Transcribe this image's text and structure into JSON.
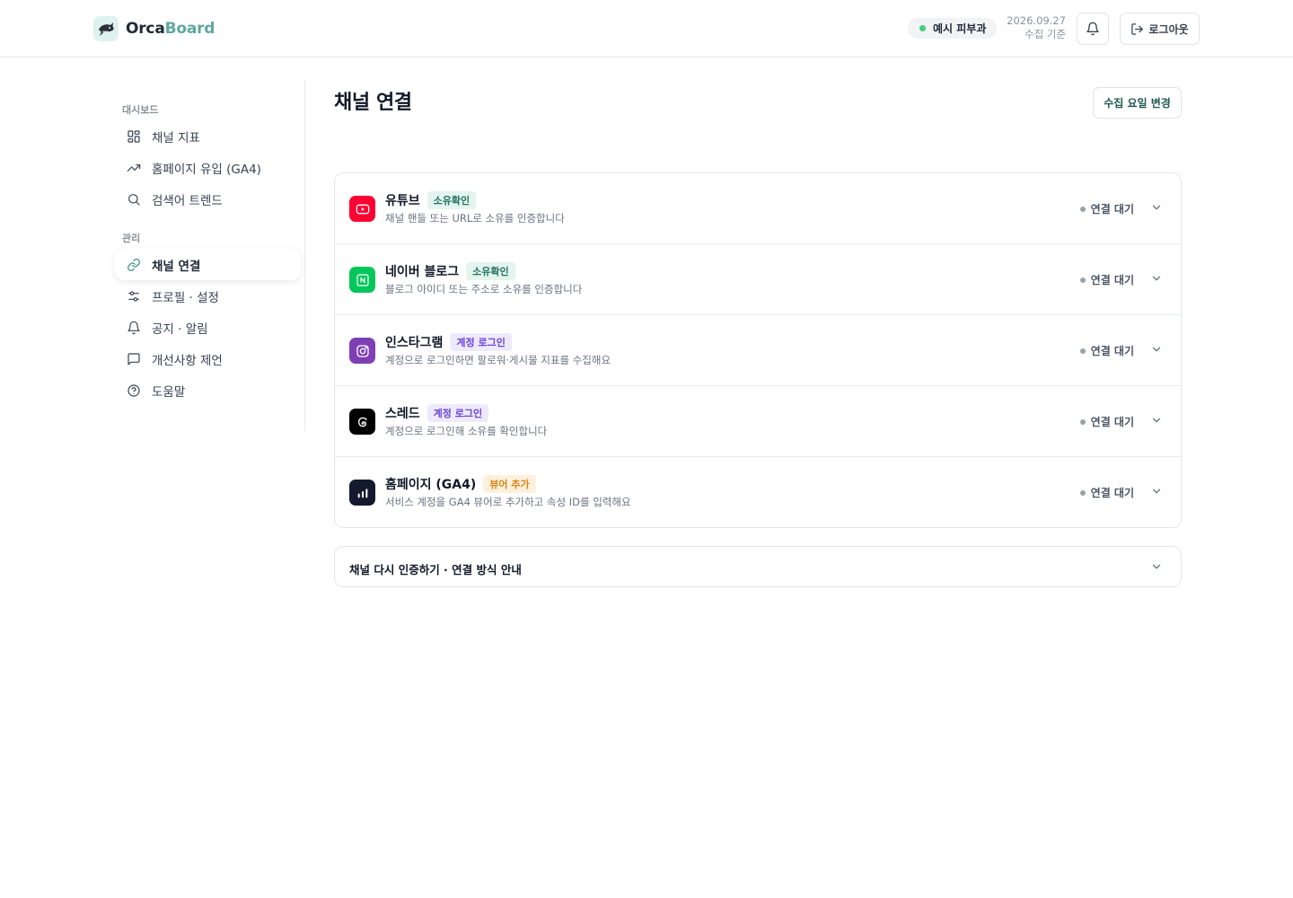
{
  "header": {
    "logo_part1": "Orca",
    "logo_part2": "Board",
    "org_name": "예시 피부과",
    "date": "2026.09.27",
    "date_caption": "수집 기준",
    "logout_label": "로그아웃",
    "status_color": "#3fcf7d"
  },
  "sidebar": {
    "section_dashboard": "대시보드",
    "section_manage": "관리",
    "items": [
      {
        "label": "채널 지표",
        "icon": "grid-icon"
      },
      {
        "label": "홈페이지 유입 (GA4)",
        "icon": "trending-up-icon"
      },
      {
        "label": "검색어 트렌드",
        "icon": "search-icon"
      },
      {
        "label": "채널 연결",
        "icon": "link-icon",
        "active": true
      },
      {
        "label": "프로필 · 설정",
        "icon": "sliders-icon"
      },
      {
        "label": "공지 · 알림",
        "icon": "bell-icon"
      },
      {
        "label": "개선사항 제언",
        "icon": "message-icon"
      },
      {
        "label": "도움말",
        "icon": "help-circle-icon"
      }
    ]
  },
  "main": {
    "title": "채널 연결",
    "change_button": "수집 요일 변경",
    "channels": [
      {
        "name": "유튜브",
        "badge": "소유확인",
        "badge_color": "green",
        "desc": "채널 핸들 또는 URL로 소유를 인증합니다",
        "status": "연결 대기",
        "icon": "youtube-icon",
        "icon_bg": "#ff0033"
      },
      {
        "name": "네이버 블로그",
        "badge": "소유확인",
        "badge_color": "green",
        "desc": "블로그 아이디 또는 주소로 소유를 인증합니다",
        "status": "연결 대기",
        "icon": "naver-blog-icon",
        "icon_bg": "#03c75a"
      },
      {
        "name": "인스타그램",
        "badge": "계정 로그인",
        "badge_color": "purple",
        "desc": "계정으로 로그인하면 팔로워·게시물 지표를 수집해요",
        "status": "연결 대기",
        "icon": "instagram-icon",
        "icon_bg": "#7e3fb4"
      },
      {
        "name": "스레드",
        "badge": "계정 로그인",
        "badge_color": "purple",
        "desc": "계정으로 로그인해 소유를 확인합니다",
        "status": "연결 대기",
        "icon": "threads-icon",
        "icon_bg": "#000000"
      },
      {
        "name": "홈페이지 (GA4)",
        "badge": "뷰어 추가",
        "badge_color": "orange",
        "desc": "서비스 계정을 GA4 뷰어로 추가하고 속성 ID를 입력해요",
        "status": "연결 대기",
        "icon": "analytics-icon",
        "icon_bg": "#141a2e"
      }
    ],
    "guide_label": "채널 다시 인증하기 · 연결 방식 안내"
  }
}
